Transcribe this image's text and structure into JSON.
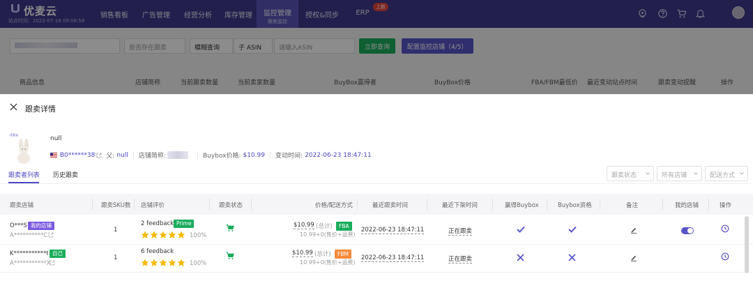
{
  "app": {
    "logo_text": "优麦云",
    "site_time": "站点时间：2022-07-18 09:06:58"
  },
  "nav": {
    "items": [
      {
        "label": "销售看板"
      },
      {
        "label": "广告管理"
      },
      {
        "label": "经营分析"
      },
      {
        "label": "库存管理"
      },
      {
        "label": "监控管理",
        "sub": "跟卖监控"
      },
      {
        "label": "授权&同步"
      },
      {
        "label": "ERP"
      }
    ],
    "erp_badge": "上新"
  },
  "background": {
    "filters": {
      "store": "",
      "stock_select": "是否存在跟卖",
      "query_mode": "模糊查询",
      "asin_type": "子 ASIN",
      "asin_placeholder": "请输入ASIN"
    },
    "buttons": {
      "search": "立即查询",
      "config": "配置监控店铺（4/5）"
    },
    "columns": [
      "商品信息",
      "店铺简称",
      "当前跟卖数量",
      "当前卖家数量",
      "BuyBox赢得者",
      "BuyBox价格",
      "FBA/FBM最低价",
      "最近变动站点时间",
      "跟卖变动提醒",
      "操作"
    ]
  },
  "drawer": {
    "title": "跟卖详情",
    "product": {
      "name": "null",
      "asin": "B0******38",
      "parent_label": "父:",
      "parent_value": "null",
      "store_label": "店铺简称:",
      "buybox_label": "Buybox价格:",
      "buybox_price": "$10.99",
      "change_label": "变动时间:",
      "change_time": "2022-06-23 18:47:11",
      "image_brand": "优麦云"
    },
    "tabs": [
      {
        "label": "跟卖者列表",
        "active": true
      },
      {
        "label": "历史跟卖",
        "active": false
      }
    ],
    "dropdowns": [
      "跟卖状态",
      "所有店铺",
      "配送方式"
    ],
    "columns": [
      "跟卖店铺",
      "跟卖SKU数",
      "店铺评价",
      "跟卖状态",
      "价格/配送方式",
      "最近跟卖时间",
      "最近下架时间",
      "赢得Buybox",
      "Buybox资格",
      "备注",
      "我的店铺",
      "操作"
    ],
    "rows": [
      {
        "seller": "O***S",
        "seller_tag": "我的店铺",
        "seller_id": "A**********C",
        "sku_count": "1",
        "feedback": "2 feedback",
        "feedback_tag": "Prime",
        "rating": "100%",
        "price": "$10.99",
        "total_label": "(总计)",
        "price_detail": "10.99+0(售价+运费)",
        "fulfillment": "FBA",
        "last_follow": "2022-06-23 18:47:11",
        "last_down": "正在跟卖",
        "win_buybox": "check",
        "buybox_eligible": "check",
        "my_store_toggle": "on"
      },
      {
        "seller": "K***********t",
        "seller_tag": "自己",
        "seller_id": "A***********X",
        "sku_count": "1",
        "feedback": "6 feedback",
        "feedback_tag": "",
        "rating": "100%",
        "price": "$10.99",
        "total_label": "(总计)",
        "price_detail": "10.99+0(售价+运费)",
        "fulfillment": "FBM",
        "last_follow": "2022-06-23 18:47:11",
        "last_down": "正在跟卖",
        "win_buybox": "cross",
        "buybox_eligible": "cross",
        "my_store_toggle": ""
      }
    ]
  },
  "colors": {
    "nav_bg": "#3e3a8c",
    "accent": "#4b47c3",
    "green": "#1aad5c",
    "orange": "#f58a3a",
    "star": "#f5b800"
  }
}
